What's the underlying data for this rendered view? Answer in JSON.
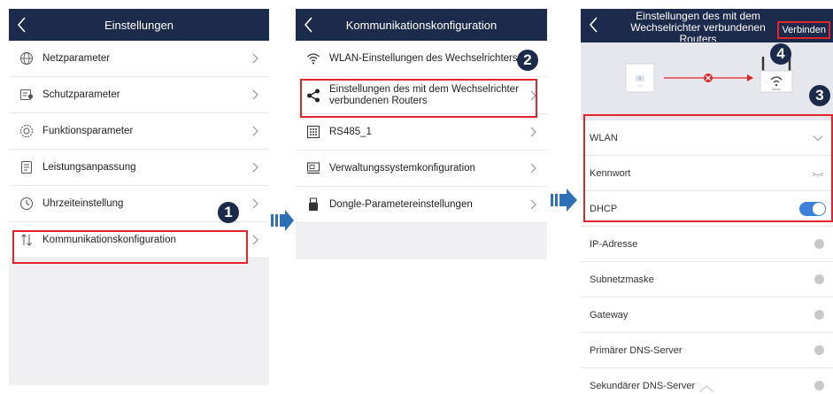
{
  "panel1": {
    "title": "Einstellungen",
    "items": [
      {
        "label": "Netzparameter",
        "icon": "globe-icon"
      },
      {
        "label": "Schutzparameter",
        "icon": "shield-icon"
      },
      {
        "label": "Funktionsparameter",
        "icon": "gear-icon"
      },
      {
        "label": "Leistungsanpassung",
        "icon": "document-icon"
      },
      {
        "label": "Uhrzeiteinstellung",
        "icon": "clock-icon"
      },
      {
        "label": "Kommunikationskonfiguration",
        "icon": "transfer-icon"
      }
    ],
    "step": "1"
  },
  "panel2": {
    "title": "Kommunikationskonfiguration",
    "items": [
      {
        "label": "WLAN-Einstellungen des Wechselrichters",
        "icon": "wifi-icon"
      },
      {
        "label": "Einstellungen des mit dem Wechselrichter verbundenen Routers",
        "icon": "share-icon"
      },
      {
        "label": "RS485_1",
        "icon": "rs485-icon"
      },
      {
        "label": "Verwaltungssystemkonfiguration",
        "icon": "monitor-icon"
      },
      {
        "label": "Dongle-Parametereinstellungen",
        "icon": "dongle-icon"
      }
    ],
    "step": "2"
  },
  "panel3": {
    "title": "Einstellungen des mit dem Wechselrichter verbundenen Routers",
    "connect_label": "Verbinden",
    "step_connect": "4",
    "step_fields": "3",
    "fields": [
      {
        "label": "WLAN",
        "control": "chevron-down-icon"
      },
      {
        "label": "Kennwort",
        "control": "eye-icon"
      },
      {
        "label": "DHCP",
        "control": "toggle-on"
      }
    ],
    "readonly_fields": [
      {
        "label": "IP-Adresse"
      },
      {
        "label": "Subnetzmaske"
      },
      {
        "label": "Gateway"
      },
      {
        "label": "Primärer DNS-Server"
      },
      {
        "label": "Sekundärer DNS-Server"
      }
    ]
  },
  "colors": {
    "header": "#1c2a4b",
    "highlight": "#e0262b",
    "accent_blue": "#3d7fd9",
    "arrow_blue": "#2e6fb5"
  }
}
